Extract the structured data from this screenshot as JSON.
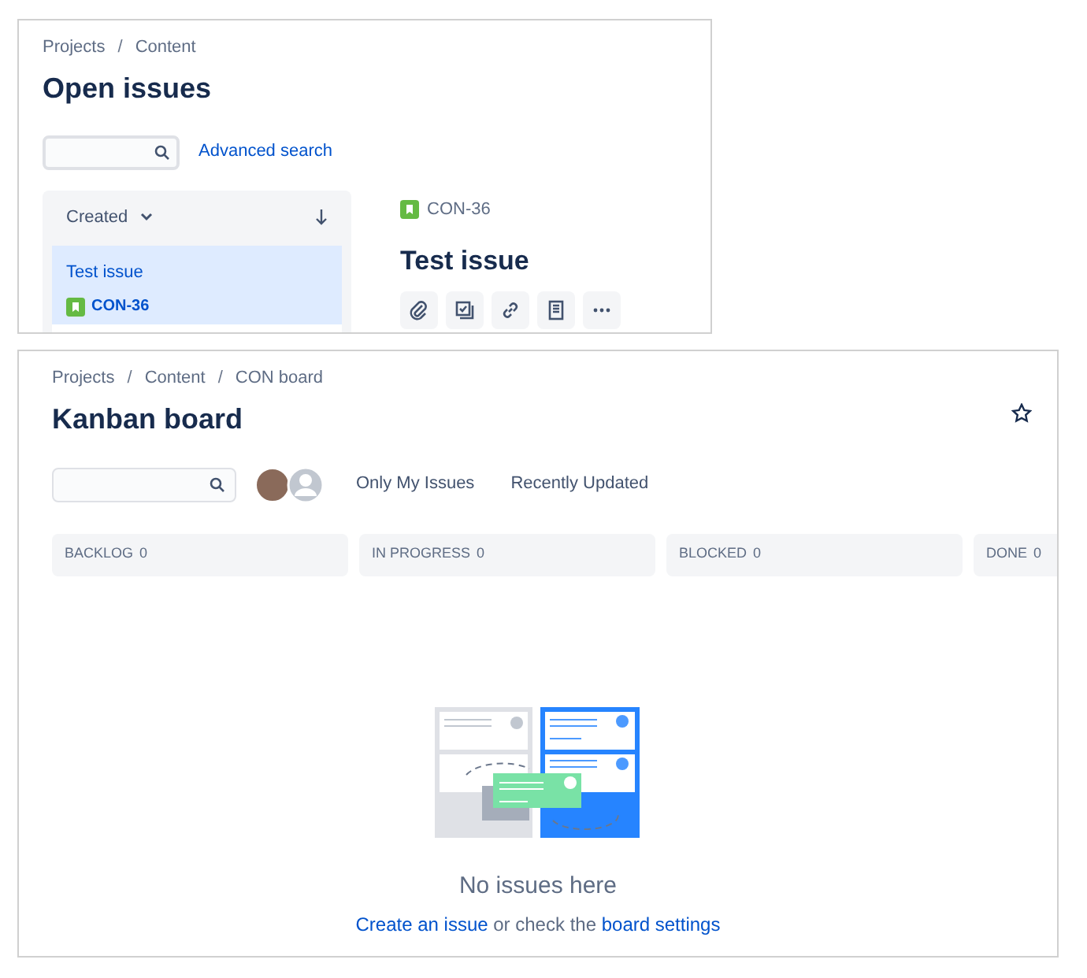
{
  "issues_panel": {
    "breadcrumbs": [
      {
        "kind": "link",
        "text": "Projects"
      },
      {
        "kind": "separator",
        "text": "/"
      },
      {
        "kind": "link",
        "text": "Content"
      }
    ],
    "title": "Open issues",
    "advanced_search": "Advanced search",
    "sort": {
      "label": "Created"
    },
    "issues": [
      {
        "title": "Test issue",
        "key": "CON-36",
        "selected": true
      }
    ],
    "detail": {
      "key": "CON-36",
      "title": "Test issue"
    }
  },
  "board": {
    "breadcrumbs": [
      {
        "kind": "link",
        "text": "Projects"
      },
      {
        "kind": "separator",
        "text": "/"
      },
      {
        "kind": "link",
        "text": "Content"
      },
      {
        "kind": "separator",
        "text": "/"
      },
      {
        "kind": "link",
        "text": "CON board"
      }
    ],
    "title": "Kanban board",
    "starred": false,
    "filters": [
      {
        "label": "Only My Issues",
        "selected": false
      },
      {
        "label": "Recently Updated",
        "selected": false
      }
    ],
    "columns": [
      {
        "name": "BACKLOG",
        "count": "0"
      },
      {
        "name": "IN PROGRESS",
        "count": "0"
      },
      {
        "name": "BLOCKED",
        "count": "0"
      },
      {
        "name": "DONE",
        "count": "0"
      }
    ],
    "empty_state": {
      "title": "No issues here",
      "message": [
        {
          "kind": "link",
          "text": "Create an issue"
        },
        {
          "kind": "text",
          "text": " or check the "
        },
        {
          "kind": "link",
          "text": "board settings"
        }
      ]
    }
  }
}
